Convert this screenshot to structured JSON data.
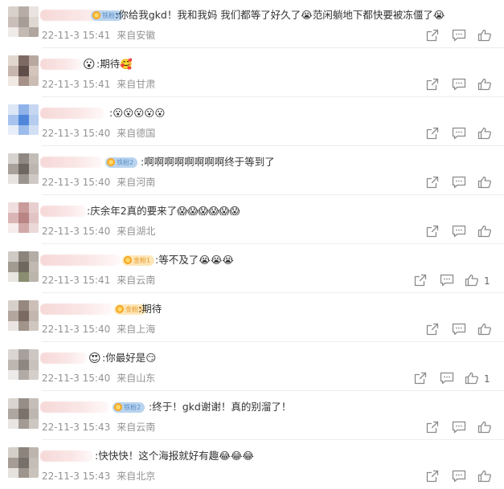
{
  "comments": [
    {
      "badge": "铁粉3",
      "pre_emoji": "",
      "text": ":你给我gkd！我和我妈 我们都等了好久了😭范闲躺地下都快要被冻僵了😭",
      "time": "22-11-3 15:41",
      "location": "来自安徽",
      "likes": ""
    },
    {
      "badge": "",
      "pre_emoji": "😮",
      "text": ":期待🥰",
      "time": "22-11-3 15:41",
      "location": "来自甘肃",
      "likes": ""
    },
    {
      "badge": "",
      "pre_emoji": "",
      "text": ":😮😮😮😮😮",
      "time": "22-11-3 15:40",
      "location": "来自德国",
      "likes": ""
    },
    {
      "badge": "铁粉2",
      "pre_emoji": "",
      "text": ":啊啊啊啊啊啊啊啊终于等到了",
      "time": "22-11-3 15:40",
      "location": "来自河南",
      "likes": ""
    },
    {
      "badge": "",
      "pre_emoji": "",
      "text": ":庆余年2真的要来了😱😱😱😱😱😱",
      "time": "22-11-3 15:40",
      "location": "来自湖北",
      "likes": ""
    },
    {
      "badge": "金粉1",
      "pre_emoji": "",
      "text": ":等不及了😭😭😭",
      "time": "22-11-3 15:41",
      "location": "来自云南",
      "likes": "1"
    },
    {
      "badge": "金粉3",
      "pre_emoji": "",
      "text": ":期待",
      "time": "22-11-3 15:40",
      "location": "来自上海",
      "likes": ""
    },
    {
      "badge": "",
      "pre_emoji": "😍",
      "text": ":你最好是😏",
      "time": "22-11-3 15:40",
      "location": "来自山东",
      "likes": "1"
    },
    {
      "badge": "铁粉2",
      "pre_emoji": "",
      "text": ":终于！gkd谢谢！真的别溜了！",
      "time": "22-11-3 15:43",
      "location": "来自云南",
      "likes": ""
    },
    {
      "badge": "",
      "pre_emoji": "",
      "text": ":快快快！这个海报就好有趣😂😂😂",
      "time": "22-11-3 15:43",
      "location": "来自北京",
      "likes": ""
    }
  ],
  "icons": {
    "share": "share-icon",
    "comment": "comment-icon",
    "like": "thumbs-up-icon"
  },
  "colors": {
    "text": "#333333",
    "meta": "#939393",
    "icon": "#8a8a8a",
    "badge_blue": "#b9d4ef",
    "badge_gold": "#fde6b8",
    "name_blur": "#f6d6d6"
  }
}
